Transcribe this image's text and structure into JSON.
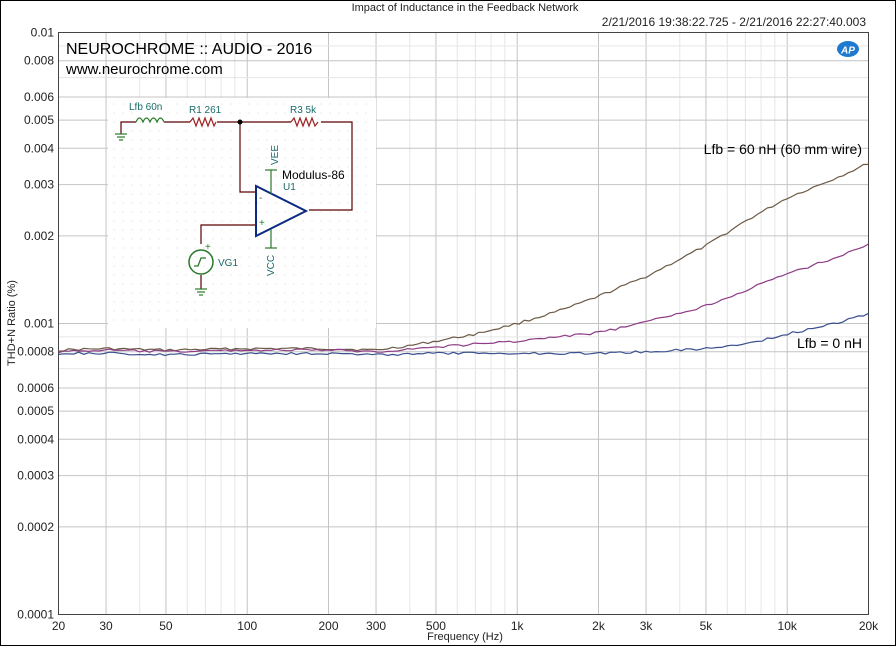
{
  "chart_data": {
    "type": "line",
    "title": "Impact of Inductance in the Feedback Network",
    "timestamp": "2/21/2016 19:38:22.725 - 2/21/2016 22:27:40.003",
    "xlabel": "Frequency (Hz)",
    "ylabel": "THD+N Ratio (%)",
    "xscale": "log",
    "yscale": "log",
    "xlim": [
      20,
      20000
    ],
    "ylim": [
      0.0001,
      0.01
    ],
    "grid": true,
    "xticks": [
      {
        "v": 20,
        "label": "20"
      },
      {
        "v": 30,
        "label": "30"
      },
      {
        "v": 50,
        "label": "50"
      },
      {
        "v": 100,
        "label": "100"
      },
      {
        "v": 200,
        "label": "200"
      },
      {
        "v": 300,
        "label": "300"
      },
      {
        "v": 500,
        "label": "500"
      },
      {
        "v": 1000,
        "label": "1k"
      },
      {
        "v": 2000,
        "label": "2k"
      },
      {
        "v": 3000,
        "label": "3k"
      },
      {
        "v": 5000,
        "label": "5k"
      },
      {
        "v": 10000,
        "label": "10k"
      },
      {
        "v": 20000,
        "label": "20k"
      }
    ],
    "yticks": [
      {
        "v": 0.01,
        "label": "0.01"
      },
      {
        "v": 0.008,
        "label": "0.008"
      },
      {
        "v": 0.006,
        "label": "0.006"
      },
      {
        "v": 0.005,
        "label": "0.005"
      },
      {
        "v": 0.004,
        "label": "0.004"
      },
      {
        "v": 0.003,
        "label": "0.003"
      },
      {
        "v": 0.002,
        "label": "0.002"
      },
      {
        "v": 0.001,
        "label": "0.001"
      },
      {
        "v": 0.0008,
        "label": "0.0008"
      },
      {
        "v": 0.0006,
        "label": "0.0006"
      },
      {
        "v": 0.0005,
        "label": "0.0005"
      },
      {
        "v": 0.0004,
        "label": "0.0004"
      },
      {
        "v": 0.0003,
        "label": "0.0003"
      },
      {
        "v": 0.0002,
        "label": "0.0002"
      },
      {
        "v": 0.0001,
        "label": "0.0001"
      }
    ],
    "series": [
      {
        "name": "",
        "color": "#6b5a45",
        "points": [
          [
            20,
            0.00081
          ],
          [
            30,
            0.00082
          ],
          [
            50,
            0.00081
          ],
          [
            100,
            0.00082
          ],
          [
            200,
            0.00082
          ],
          [
            300,
            0.00081
          ],
          [
            400,
            0.00084
          ],
          [
            500,
            0.00087
          ],
          [
            700,
            0.00092
          ],
          [
            1000,
            0.001
          ],
          [
            1500,
            0.00112
          ],
          [
            2000,
            0.00124
          ],
          [
            3000,
            0.00145
          ],
          [
            5000,
            0.00185
          ],
          [
            7000,
            0.00225
          ],
          [
            10000,
            0.0027
          ],
          [
            15000,
            0.00315
          ],
          [
            20000,
            0.00355
          ]
        ]
      },
      {
        "name": "",
        "color": "#8e3c86",
        "points": [
          [
            20,
            0.0008
          ],
          [
            30,
            0.00081
          ],
          [
            50,
            0.0008
          ],
          [
            100,
            0.00081
          ],
          [
            200,
            0.00081
          ],
          [
            300,
            0.0008
          ],
          [
            500,
            0.00083
          ],
          [
            700,
            0.00085
          ],
          [
            1000,
            0.00087
          ],
          [
            2000,
            0.00093
          ],
          [
            3000,
            0.00101
          ],
          [
            5000,
            0.00115
          ],
          [
            7000,
            0.0013
          ],
          [
            10000,
            0.00148
          ],
          [
            15000,
            0.00168
          ],
          [
            20000,
            0.00188
          ]
        ]
      },
      {
        "name": "",
        "color": "#3a4f8f",
        "points": [
          [
            20,
            0.00079
          ],
          [
            30,
            0.00079
          ],
          [
            50,
            0.00078
          ],
          [
            100,
            0.00079
          ],
          [
            200,
            0.00079
          ],
          [
            300,
            0.00078
          ],
          [
            500,
            0.00079
          ],
          [
            1000,
            0.00079
          ],
          [
            2000,
            0.00079
          ],
          [
            3000,
            0.0008
          ],
          [
            5000,
            0.00082
          ],
          [
            7000,
            0.00085
          ],
          [
            10000,
            0.00092
          ],
          [
            15000,
            0.001
          ],
          [
            20000,
            0.00108
          ]
        ]
      }
    ],
    "annotations": {
      "label_60nh": "Lfb = 60 nH (60 mm wire)",
      "label_0nh": "Lfb = 0 nH"
    }
  },
  "brand": {
    "title": "NEUROCHROME :: AUDIO - 2016",
    "url": "www.neurochrome.com",
    "logo_text": "AP"
  },
  "schematic": {
    "lfb": "Lfb 60n",
    "r1": "R1 261",
    "r3": "R3 5k",
    "opamp": "Modulus-86",
    "u1": "U1",
    "vee": "VEE",
    "vcc": "VCC",
    "vg1": "VG1",
    "plus": "+",
    "minus": "-"
  }
}
